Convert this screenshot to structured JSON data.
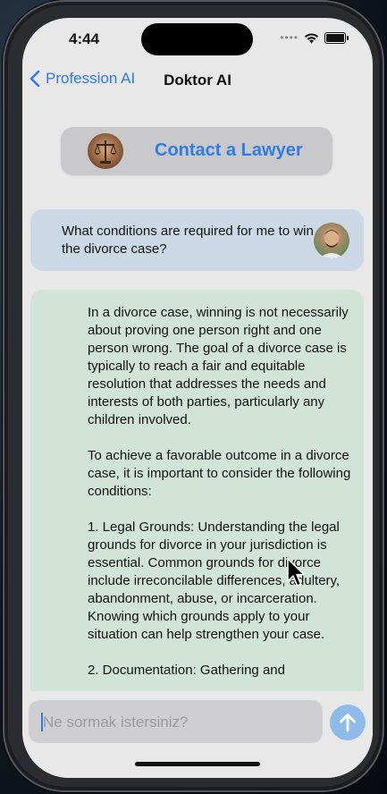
{
  "status_bar": {
    "time": "4:44",
    "dots": "••••"
  },
  "nav": {
    "back_label": "Profession AI",
    "title": "Doktor AI"
  },
  "lawyer_button": {
    "label": "Contact a Lawyer",
    "avatar_icon": "scales-of-justice-icon"
  },
  "user_message": {
    "text": "What conditions are required for me to win the divorce case?",
    "avatar_icon": "user-avatar"
  },
  "ai_message": {
    "paragraphs": [
      "In a divorce case, winning is not necessarily about proving one person right and one person wrong. The goal of a divorce case is typically to reach a fair and equitable resolution that addresses the needs and interests of both parties, particularly any children involved.",
      "To achieve a favorable outcome in a divorce case, it is important to consider the following conditions:",
      "1. Legal Grounds: Understanding the legal grounds for divorce in your jurisdiction is essential. Common grounds for divorce include irreconcilable differences, adultery, abandonment, abuse, or incarceration. Knowing which grounds apply to your situation can help strengthen your case.",
      "2. Documentation: Gathering and"
    ]
  },
  "input": {
    "placeholder": "Ne sormak istersiniz?",
    "value": ""
  },
  "send_icon": "arrow-up-icon",
  "colors": {
    "accent": "#2f7be8",
    "user_bubble": "#ccd8e6",
    "ai_bubble": "#d2e3d8",
    "send_button": "#8fbbe8"
  }
}
